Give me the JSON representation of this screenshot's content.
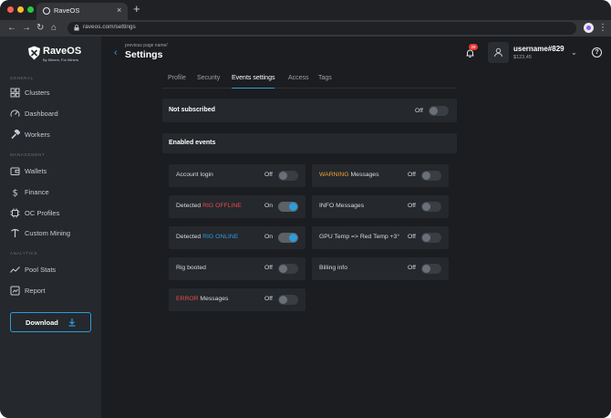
{
  "browser": {
    "tab_title": "RaveOS",
    "tab_close": "×",
    "new_tab": "+",
    "back": "←",
    "forward": "→",
    "reload": "↻",
    "home": "⌂",
    "url": "raveos.com/settings",
    "menu": "⋮"
  },
  "brand": {
    "name": "RaveOS",
    "tagline": "By Miners, For Miners"
  },
  "sidebar": {
    "sections": [
      {
        "label": "GENERAL",
        "items": [
          {
            "label": "Clusters",
            "icon": "grid-icon"
          },
          {
            "label": "Dashboard",
            "icon": "gauge-icon"
          },
          {
            "label": "Workers",
            "icon": "hammer-icon"
          }
        ]
      },
      {
        "label": "MANAGEMENT",
        "items": [
          {
            "label": "Wallets",
            "icon": "wallet-icon"
          },
          {
            "label": "Finance",
            "icon": "dollar-icon"
          },
          {
            "label": "OC Profiles",
            "icon": "chip-icon"
          },
          {
            "label": "Custom Mining",
            "icon": "pickaxe-icon"
          }
        ]
      },
      {
        "label": "ANALYTICS",
        "items": [
          {
            "label": "Pool Stats",
            "icon": "chart-line-icon"
          },
          {
            "label": "Report",
            "icon": "report-icon"
          }
        ]
      }
    ],
    "download_label": "Download"
  },
  "header": {
    "back_icon": "‹",
    "previous_page": "previous page name/",
    "title": "Settings",
    "notifications_count": "29",
    "username": "username#829",
    "balance": "$123,45",
    "user_menu_chevron": "⌄",
    "help_icon": "?"
  },
  "settings_tabs": [
    {
      "label": "Profile",
      "active": false
    },
    {
      "label": "Security",
      "active": false
    },
    {
      "label": "Events settings",
      "active": true
    },
    {
      "label": "Access",
      "active": false
    },
    {
      "label": "Tags",
      "active": false
    }
  ],
  "subscription": {
    "label": "Not subscribed",
    "state": "Off",
    "on": false
  },
  "enabled_events": {
    "title": "Enabled events",
    "left": [
      {
        "prefix": "Account login",
        "highlight": "",
        "suffix": "",
        "highlight_color": "",
        "state": "Off",
        "on": false
      },
      {
        "prefix": "Detected ",
        "highlight": "RIG OFFLINE",
        "suffix": "",
        "highlight_color": "#e74c4c",
        "state": "On",
        "on": true
      },
      {
        "prefix": "Detected ",
        "highlight": "RIG ONLINE",
        "suffix": "",
        "highlight_color": "#2d9cdb",
        "state": "On",
        "on": true
      },
      {
        "prefix": "Rig booted",
        "highlight": "",
        "suffix": "",
        "highlight_color": "",
        "state": "Off",
        "on": false
      },
      {
        "prefix": "",
        "highlight": "ERROR",
        "suffix": " Messages",
        "highlight_color": "#e74c4c",
        "state": "Off",
        "on": false
      }
    ],
    "right": [
      {
        "prefix": "",
        "highlight": "WARNING",
        "suffix": " Messages",
        "highlight_color": "#f0a030",
        "state": "Off",
        "on": false
      },
      {
        "prefix": "INFO Messages",
        "highlight": "",
        "suffix": "",
        "highlight_color": "",
        "state": "Off",
        "on": false
      },
      {
        "prefix": "GPU Temp => Red Temp +3°",
        "highlight": "",
        "suffix": "",
        "highlight_color": "",
        "state": "Off",
        "on": false
      },
      {
        "prefix": "Billing info",
        "highlight": "",
        "suffix": "",
        "highlight_color": "",
        "state": "Off",
        "on": false
      }
    ]
  },
  "colors": {
    "accent": "#2d9cdb",
    "sidebar_bg": "#25282c",
    "main_bg": "#1b1d20",
    "danger": "#e74c4c",
    "warning": "#f0a030"
  }
}
